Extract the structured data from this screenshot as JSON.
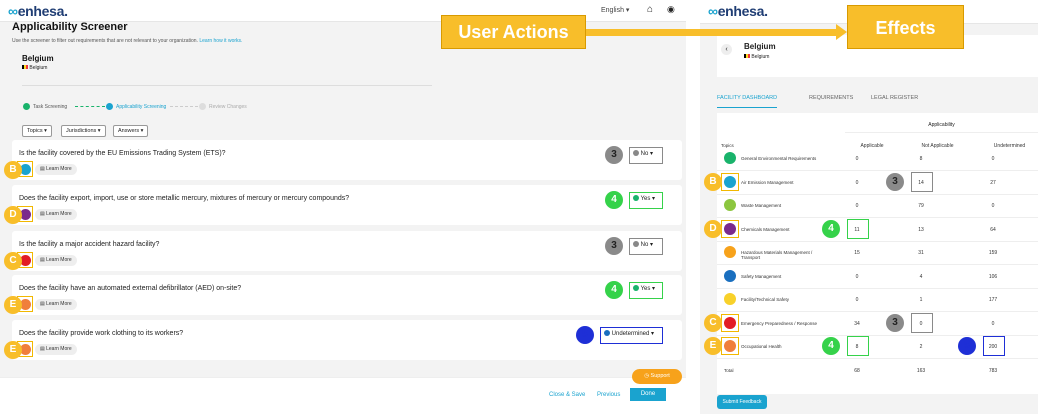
{
  "left": {
    "brand": "enhesa.",
    "language": "English",
    "title": "Applicability Screener",
    "subtitle": "Use the screener to filter out requirements that are not relevant to your organization.",
    "subtitle_link": "Learn how it works.",
    "facility": "Belgium",
    "facility_flag_label": "Belgium",
    "steps": [
      "Task Screening",
      "Applicability Screening",
      "Review Changes"
    ],
    "filters": [
      "Topics",
      "Jurisdictions",
      "Answers"
    ],
    "learn_more": "Learn More",
    "questions": [
      {
        "text": "Is the facility covered by the EU Emissions Trading System (ETS)?",
        "letter": "B",
        "badge": "3",
        "answer": "No"
      },
      {
        "text": "Does the facility export, import, use or store metallic mercury, mixtures of mercury or mercury compounds?",
        "letter": "D",
        "badge": "4",
        "answer": "Yes"
      },
      {
        "text": "Is the facility a major accident hazard facility?",
        "letter": "C",
        "badge": "3",
        "answer": "No"
      },
      {
        "text": "Does the facility have an automated external defibrillator (AED) on-site?",
        "letter": "E",
        "badge": "4",
        "answer": "Yes"
      },
      {
        "text": "Does the facility provide work clothing to its workers?",
        "letter": "E",
        "badge": "5",
        "answer": "Undetermined"
      }
    ],
    "support": "Support",
    "close_save": "Close & Save",
    "previous": "Previous",
    "done": "Done"
  },
  "callouts": {
    "user_actions": "User Actions",
    "effects": "Effects"
  },
  "right": {
    "brand": "enhesa.",
    "facility": "Belgium",
    "facility_flag_label": "Belgium",
    "tabs": [
      "FACILITY DASHBOARD",
      "REQUIREMENTS",
      "LEGAL REGISTER"
    ],
    "applicability_header": "Applicability",
    "columns": [
      "Topics",
      "Applicable",
      "Not Applicable",
      "Undetermined"
    ],
    "rows": [
      {
        "topic": "General Environmental Requirements",
        "applicable": "0",
        "not_applicable": "8",
        "undetermined": "0",
        "letter": "",
        "color": "#19b36b"
      },
      {
        "topic": "Air Emission Management",
        "applicable": "0",
        "not_applicable": "14",
        "undetermined": "27",
        "letter": "B",
        "color": "#1aa3cf"
      },
      {
        "topic": "Waste Management",
        "applicable": "0",
        "not_applicable": "79",
        "undetermined": "0",
        "letter": "",
        "color": "#8cc63f"
      },
      {
        "topic": "Chemicals Management",
        "applicable": "11",
        "not_applicable": "13",
        "undetermined": "64",
        "letter": "D",
        "color": "#7b2a8c"
      },
      {
        "topic": "Hazardous Materials Management / Transport",
        "applicable": "15",
        "not_applicable": "31",
        "undetermined": "159",
        "letter": "",
        "color": "#f7a21b"
      },
      {
        "topic": "Safety Management",
        "applicable": "0",
        "not_applicable": "4",
        "undetermined": "106",
        "letter": "",
        "color": "#1a6fbf"
      },
      {
        "topic": "Facility/Technical Safety",
        "applicable": "0",
        "not_applicable": "1",
        "undetermined": "177",
        "letter": "",
        "color": "#f8d12a"
      },
      {
        "topic": "Emergency Preparedness / Response",
        "applicable": "34",
        "not_applicable": "0",
        "undetermined": "0",
        "letter": "C",
        "color": "#e21d25"
      },
      {
        "topic": "Occupational Health",
        "applicable": "8",
        "not_applicable": "2",
        "undetermined": "200",
        "letter": "E",
        "color": "#f07f3c"
      }
    ],
    "total_label": "Total",
    "totals": [
      "68",
      "163",
      "783"
    ],
    "row_badges": [
      {
        "row": 1,
        "col": "not_applicable",
        "badge": "3"
      },
      {
        "row": 3,
        "col": "applicable",
        "badge": "4"
      },
      {
        "row": 7,
        "col": "not_applicable",
        "badge": "3"
      },
      {
        "row": 8,
        "col": "applicable",
        "badge": "4"
      },
      {
        "row": 8,
        "col": "undetermined",
        "badge": "5"
      }
    ],
    "submit_feedback": "Submit Feedback"
  },
  "colors": {
    "green": "#35d24a",
    "gray": "#8a8a8a",
    "blue": "#1e2fd6",
    "yellow": "#f8be2a",
    "accent": "#1aa3cf"
  }
}
